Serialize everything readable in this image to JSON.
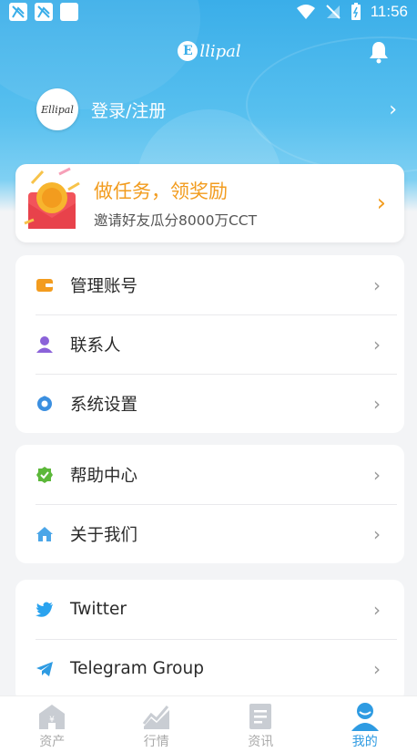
{
  "status": {
    "time": "11:56"
  },
  "header": {
    "brand": "llipal",
    "brand_badge": "E"
  },
  "login": {
    "avatar_text": "Ellipal",
    "label": "登录/注册"
  },
  "promo": {
    "title": "做任务，领奖励",
    "subtitle": "邀请好友瓜分8000万CCT"
  },
  "menu_group_1": [
    {
      "label": "管理账号",
      "icon": "wallet-icon",
      "color": "#f39c1e"
    },
    {
      "label": "联系人",
      "icon": "person-icon",
      "color": "#8b62d9"
    },
    {
      "label": "系统设置",
      "icon": "gear-icon",
      "color": "#3b8fe0"
    }
  ],
  "menu_group_2": [
    {
      "label": "帮助中心",
      "icon": "check-badge-icon",
      "color": "#5cb83a"
    },
    {
      "label": "关于我们",
      "icon": "home-icon",
      "color": "#4ba6e8"
    }
  ],
  "menu_group_3": [
    {
      "label": "Twitter",
      "icon": "twitter-icon",
      "color": "#2aa3ef"
    },
    {
      "label": "Telegram Group",
      "icon": "telegram-icon",
      "color": "#2e9be2"
    }
  ],
  "tabs": [
    {
      "label": "资产",
      "icon": "assets-icon",
      "active": false
    },
    {
      "label": "行情",
      "icon": "market-icon",
      "active": false
    },
    {
      "label": "资讯",
      "icon": "news-icon",
      "active": false
    },
    {
      "label": "我的",
      "icon": "profile-icon",
      "active": true
    }
  ],
  "colors": {
    "accent": "#2e9be2",
    "promo": "#f29c1f",
    "header": "#3aaee9"
  }
}
